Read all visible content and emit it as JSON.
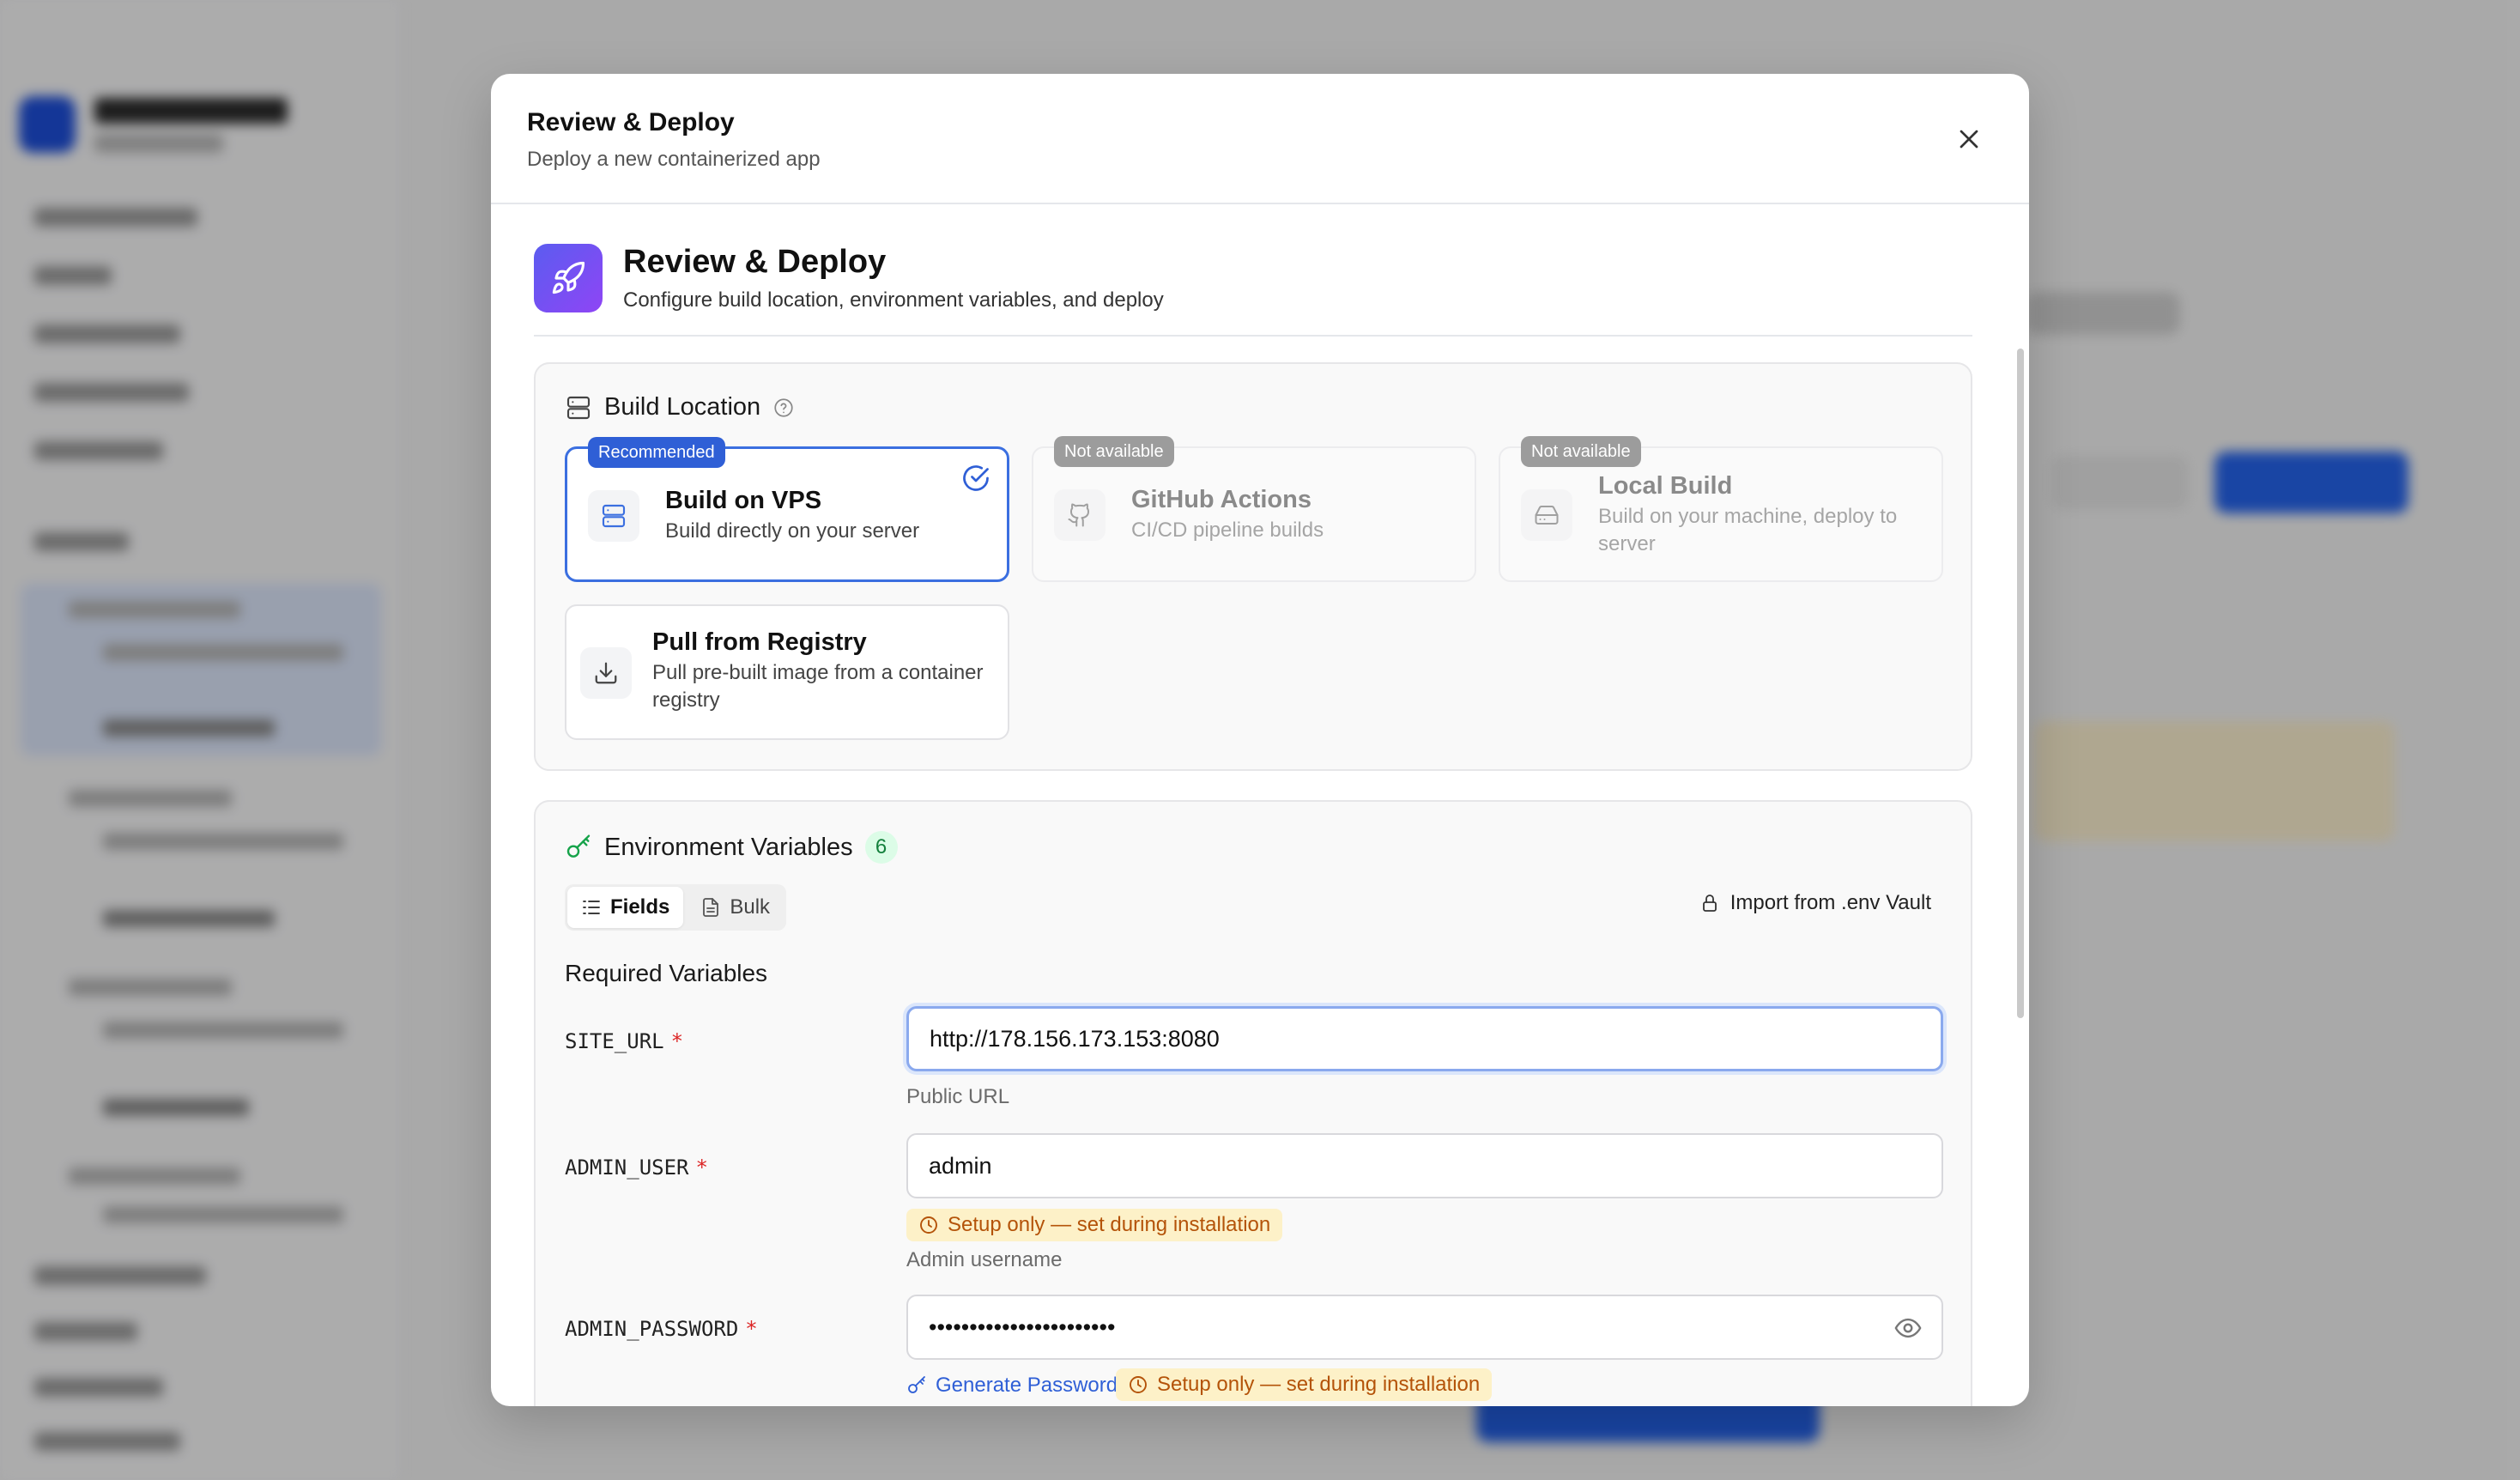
{
  "modal": {
    "title": "Review & Deploy",
    "subtitle": "Deploy a new containerized app"
  },
  "step": {
    "title": "Review & Deploy",
    "subtitle": "Configure build location, environment variables, and deploy",
    "icon": "rocket-icon",
    "accent_gradient": [
      "#5b5cf0",
      "#8f45f5"
    ]
  },
  "build_location": {
    "title": "Build Location",
    "options": [
      {
        "title": "Build on VPS",
        "description": "Build directly on your server",
        "badge": "Recommended",
        "selected": true,
        "available": true,
        "icon": "server-icon"
      },
      {
        "title": "GitHub Actions",
        "description": "CI/CD pipeline builds",
        "badge": "Not available",
        "selected": false,
        "available": false,
        "icon": "github-icon"
      },
      {
        "title": "Local Build",
        "description": "Build on your machine, deploy to server",
        "badge": "Not available",
        "selected": false,
        "available": false,
        "icon": "hard-drive-icon"
      },
      {
        "title": "Pull from Registry",
        "description": "Pull pre-built image from a container registry",
        "badge": "",
        "selected": false,
        "available": true,
        "icon": "download-icon"
      }
    ]
  },
  "env": {
    "title": "Environment Variables",
    "count": "6",
    "tabs": [
      {
        "label": "Fields",
        "active": true
      },
      {
        "label": "Bulk",
        "active": false
      }
    ],
    "import_label": "Import from .env Vault",
    "required_heading": "Required Variables",
    "setup_note": "Setup only — set during installation",
    "generate_label": "Generate Password",
    "variables": [
      {
        "key": "SITE_URL",
        "value": "http://178.156.173.153:8080",
        "hint": "Public URL"
      },
      {
        "key": "ADMIN_USER",
        "value": "admin",
        "hint": "Admin username"
      },
      {
        "key": "ADMIN_PASSWORD",
        "value": "•••••••••••••••••••••••",
        "hint": ""
      }
    ]
  },
  "colors": {
    "primary": "#2f5fd6",
    "required": "#dc2626",
    "warning_bg": "#fdf1c8",
    "warning_text": "#b45309",
    "success_bg": "#dcfce7",
    "success_text": "#15803d"
  }
}
